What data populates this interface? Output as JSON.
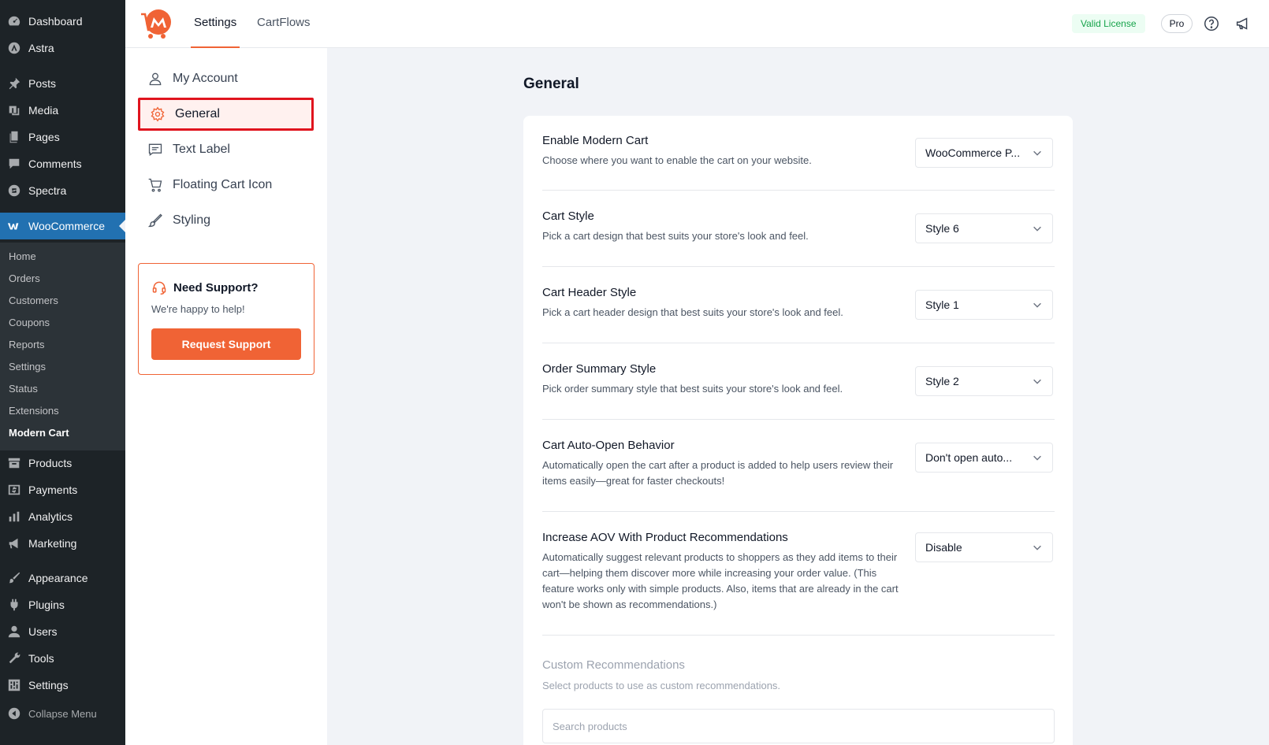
{
  "wp_menu": {
    "items": [
      {
        "label": "Dashboard",
        "icon": "dashboard-icon"
      },
      {
        "label": "Astra",
        "icon": "astra-icon"
      },
      {
        "label": "Posts",
        "icon": "pin-icon"
      },
      {
        "label": "Media",
        "icon": "media-icon"
      },
      {
        "label": "Pages",
        "icon": "pages-icon"
      },
      {
        "label": "Comments",
        "icon": "comment-icon"
      },
      {
        "label": "Spectra",
        "icon": "spectra-icon"
      },
      {
        "label": "WooCommerce",
        "icon": "woocommerce-icon"
      },
      {
        "label": "Products",
        "icon": "archive-icon"
      },
      {
        "label": "Payments",
        "icon": "payments-icon"
      },
      {
        "label": "Analytics",
        "icon": "analytics-icon"
      },
      {
        "label": "Marketing",
        "icon": "megaphone-icon"
      },
      {
        "label": "Appearance",
        "icon": "brush-icon"
      },
      {
        "label": "Plugins",
        "icon": "plugin-icon"
      },
      {
        "label": "Users",
        "icon": "user-icon"
      },
      {
        "label": "Tools",
        "icon": "wrench-icon"
      },
      {
        "label": "Settings",
        "icon": "settings-icon"
      }
    ],
    "woo_submenu": [
      "Home",
      "Orders",
      "Customers",
      "Coupons",
      "Reports",
      "Settings",
      "Status",
      "Extensions",
      "Modern Cart"
    ],
    "collapse_label": "Collapse Menu"
  },
  "header": {
    "tabs": [
      "Settings",
      "CartFlows"
    ],
    "license_badge": "Valid License",
    "plan_badge": "Pro"
  },
  "settings_nav": {
    "items": [
      "My Account",
      "General",
      "Text Label",
      "Floating Cart Icon",
      "Styling"
    ],
    "active": "General"
  },
  "support": {
    "title": "Need Support?",
    "description": "We're happy to help!",
    "button": "Request Support"
  },
  "main": {
    "title": "General",
    "settings": [
      {
        "title": "Enable Modern Cart",
        "description": "Choose where you want to enable the cart on your website.",
        "value": "WooCommerce P..."
      },
      {
        "title": "Cart Style",
        "description": "Pick a cart design that best suits your store's look and feel.",
        "value": "Style 6"
      },
      {
        "title": "Cart Header Style",
        "description": "Pick a cart header design that best suits your store's look and feel.",
        "value": "Style 1"
      },
      {
        "title": "Order Summary Style",
        "description": "Pick order summary style that best suits your store's look and feel.",
        "value": "Style 2"
      },
      {
        "title": "Cart Auto-Open Behavior",
        "description": "Automatically open the cart after a product is added to help users review their items easily—great for faster checkouts!",
        "value": "Don't open auto..."
      },
      {
        "title": "Increase AOV With Product Recommendations",
        "description": "Automatically suggest relevant products to shoppers as they add items to their cart—helping them discover more while increasing your order value. (This feature works only with simple products. Also, items that are already in the cart won't be shown as recommendations.)",
        "value": "Disable"
      }
    ],
    "custom_recommendations": {
      "title": "Custom Recommendations",
      "description": "Select products to use as custom recommendations.",
      "search_placeholder": "Search products"
    }
  },
  "colors": {
    "accent": "#f06335",
    "wp_sidebar": "#1d2327",
    "wp_active": "#2271b1",
    "highlight_border": "#e0141e"
  }
}
